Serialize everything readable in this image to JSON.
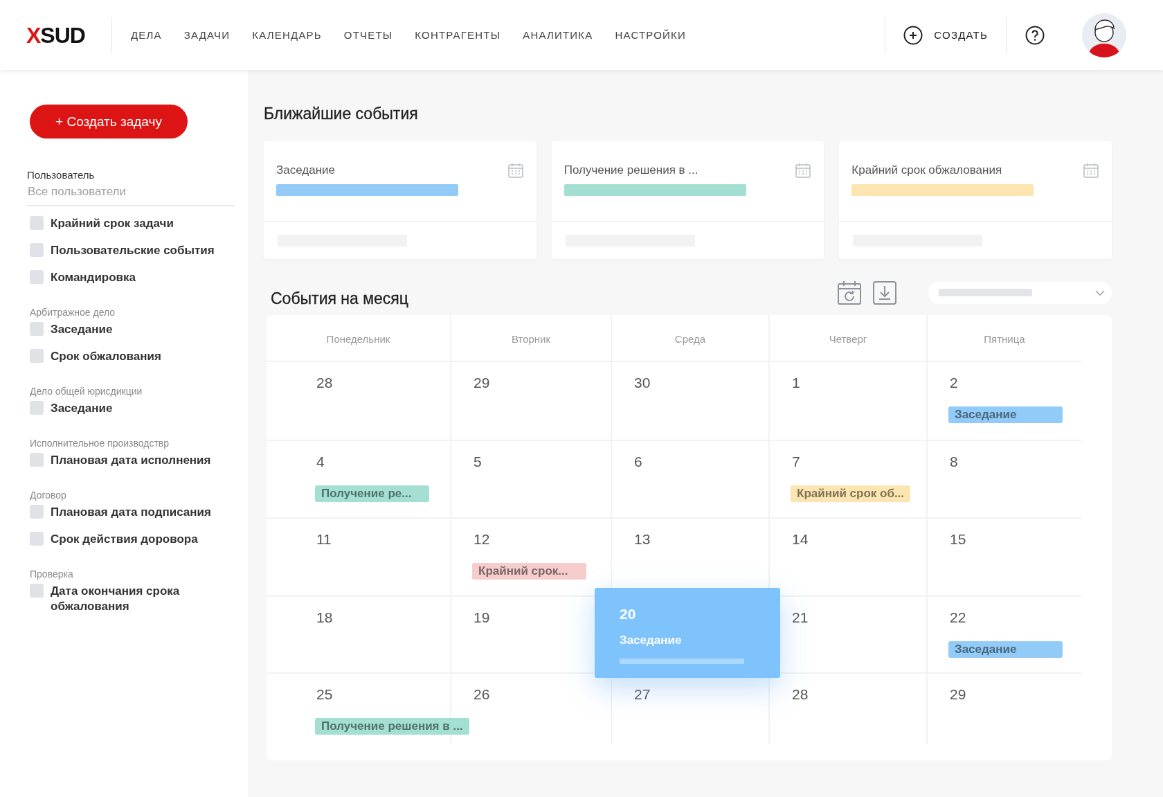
{
  "header": {
    "logo": "XSUD",
    "nav": [
      {
        "label": "ДЕЛА",
        "selected": false
      },
      {
        "label": "ЗАДАЧИ",
        "selected": false
      },
      {
        "label": "КАЛЕНДАРЬ",
        "selected": false
      },
      {
        "label": "ОТЧЕТЫ",
        "selected": false
      },
      {
        "label": "КОНТРАГЕНТЫ",
        "selected": false
      },
      {
        "label": "АНАЛИТИКА",
        "selected": false
      },
      {
        "label": "НАСТРОЙКИ",
        "selected": false
      }
    ],
    "create_label": "СОЗДАТЬ"
  },
  "sidebar": {
    "create_button": "+ Создать задачу",
    "user_filter": {
      "label": "Пользователь",
      "placeholder": "Все пользователи"
    },
    "groups": [
      {
        "items": [
          {
            "label": "Крайний срок задачи",
            "checked": false
          },
          {
            "label": "Пользовательские события",
            "checked": false
          },
          {
            "label": "Командировка",
            "checked": false
          }
        ]
      },
      {
        "heading": "Арбитражное дело",
        "items": [
          {
            "label": "Заседание",
            "checked": false
          },
          {
            "label": "Срок обжалования",
            "checked": false
          }
        ]
      },
      {
        "heading": "Дело общей юрисдикции",
        "items": [
          {
            "label": "Заседание",
            "checked": false
          }
        ]
      },
      {
        "heading": "Исполнительное производствр",
        "items": [
          {
            "label": "Плановая дата исполнения",
            "checked": false
          }
        ]
      },
      {
        "heading": "Договор",
        "items": [
          {
            "label": "Плановая дата подписания",
            "checked": false
          },
          {
            "label": "Срок действия доровора",
            "checked": false
          }
        ]
      },
      {
        "heading": "Проверка",
        "items": [
          {
            "label": "Дата окончания срока обжалования",
            "checked": false
          }
        ]
      }
    ]
  },
  "upcoming": {
    "title": "Ближайшие события",
    "cards": [
      {
        "title": "Заседание",
        "color": "#92cbf7"
      },
      {
        "title": "Получение решения в ...",
        "color": "#a3e0d3"
      },
      {
        "title": "Крайний срок обжалования",
        "color": "#fce5b0"
      }
    ]
  },
  "month": {
    "title": "События на месяц",
    "weekdays": [
      "Понедельник",
      "Вторник",
      "Среда",
      "Четверг",
      "Пятница"
    ],
    "weeks": [
      [
        {
          "day": "28",
          "selected": false
        },
        {
          "day": "29",
          "selected": false
        },
        {
          "day": "30",
          "selected": false
        },
        {
          "day": "1",
          "selected": false
        },
        {
          "day": "2",
          "selected": false,
          "events": [
            {
              "label": "Заседание",
              "color": "#92cbf7"
            }
          ]
        }
      ],
      [
        {
          "day": "4",
          "selected": false,
          "events": [
            {
              "label": "Получение ре...",
              "color": "#a3e0d3"
            }
          ]
        },
        {
          "day": "5",
          "selected": false
        },
        {
          "day": "6",
          "selected": false
        },
        {
          "day": "7",
          "selected": false,
          "events": [
            {
              "label": "Крайний срок об...",
              "color": "#fce5b0"
            }
          ]
        },
        {
          "day": "8",
          "selected": false
        }
      ],
      [
        {
          "day": "11",
          "selected": false
        },
        {
          "day": "12",
          "selected": false,
          "events": [
            {
              "label": "Крайний срок...",
              "color": "#f6cccc"
            }
          ]
        },
        {
          "day": "13",
          "selected": false
        },
        {
          "day": "14",
          "selected": false
        },
        {
          "day": "15",
          "selected": false
        }
      ],
      [
        {
          "day": "18",
          "selected": false
        },
        {
          "day": "19",
          "selected": false
        },
        {
          "day": "20",
          "selected": true,
          "events": [
            {
              "label": "Заседание",
              "color": "#7fc3fd"
            }
          ]
        },
        {
          "day": "21",
          "selected": false
        },
        {
          "day": "22",
          "selected": false,
          "events": [
            {
              "label": "Заседание",
              "color": "#92cbf7"
            }
          ]
        }
      ],
      [
        {
          "day": "25",
          "selected": false,
          "events": [
            {
              "label": "Получение решения в ...",
              "color": "#a3e0d3"
            }
          ]
        },
        {
          "day": "26",
          "selected": false
        },
        {
          "day": "27",
          "selected": false
        },
        {
          "day": "28",
          "selected": false
        },
        {
          "day": "29",
          "selected": false
        }
      ]
    ]
  }
}
